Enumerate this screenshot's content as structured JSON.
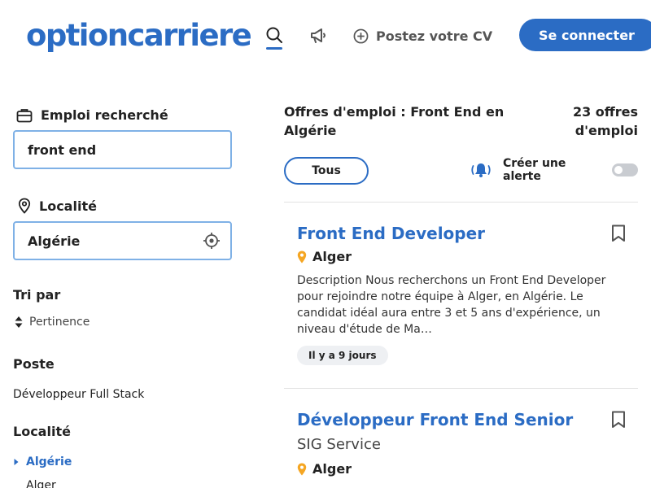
{
  "header": {
    "logo": "optioncarriere",
    "post_cv": "Postez votre CV",
    "connect": "Se connecter"
  },
  "colors": {
    "brand": "#2b6cc4",
    "location_pin": "#f5a623",
    "field_border": "#7fb1e6"
  },
  "sidebar": {
    "job_label": "Emploi recherché",
    "job_value": "front end",
    "location_label": "Localité",
    "location_value": "Algérie",
    "sort_heading": "Tri par",
    "sort_value": "Pertinence",
    "poste_heading": "Poste",
    "poste_item": "Développeur Full Stack",
    "locality_heading": "Localité",
    "locality_items": [
      "Algérie",
      "Alger"
    ]
  },
  "results": {
    "title": "Offres d'emploi : Front End en Algérie",
    "count": "23 offres d'emploi",
    "filter_all": "Tous",
    "alert_label": "Créer une alerte",
    "alert_enabled": false
  },
  "jobs": [
    {
      "title": "Front End Developer",
      "location": "Alger",
      "description": "Description Nous recherchons un Front End Developer pour rejoindre notre équipe à Alger, en Algérie. Le candidat idéal aura entre 3 et 5 ans d'expérience, un niveau d'étude de Ma…",
      "age": "Il y a 9 jours"
    },
    {
      "title": "Développeur Front End Senior",
      "company": "SIG Service",
      "location": "Alger"
    }
  ],
  "icons": [
    "search-icon",
    "megaphone-icon",
    "plus-circle-icon",
    "briefcase-icon",
    "map-pin-icon",
    "crosshair-icon",
    "sort-arrows-icon",
    "caret-right-icon",
    "bell-icon",
    "bookmark-icon",
    "location-pin-icon"
  ]
}
